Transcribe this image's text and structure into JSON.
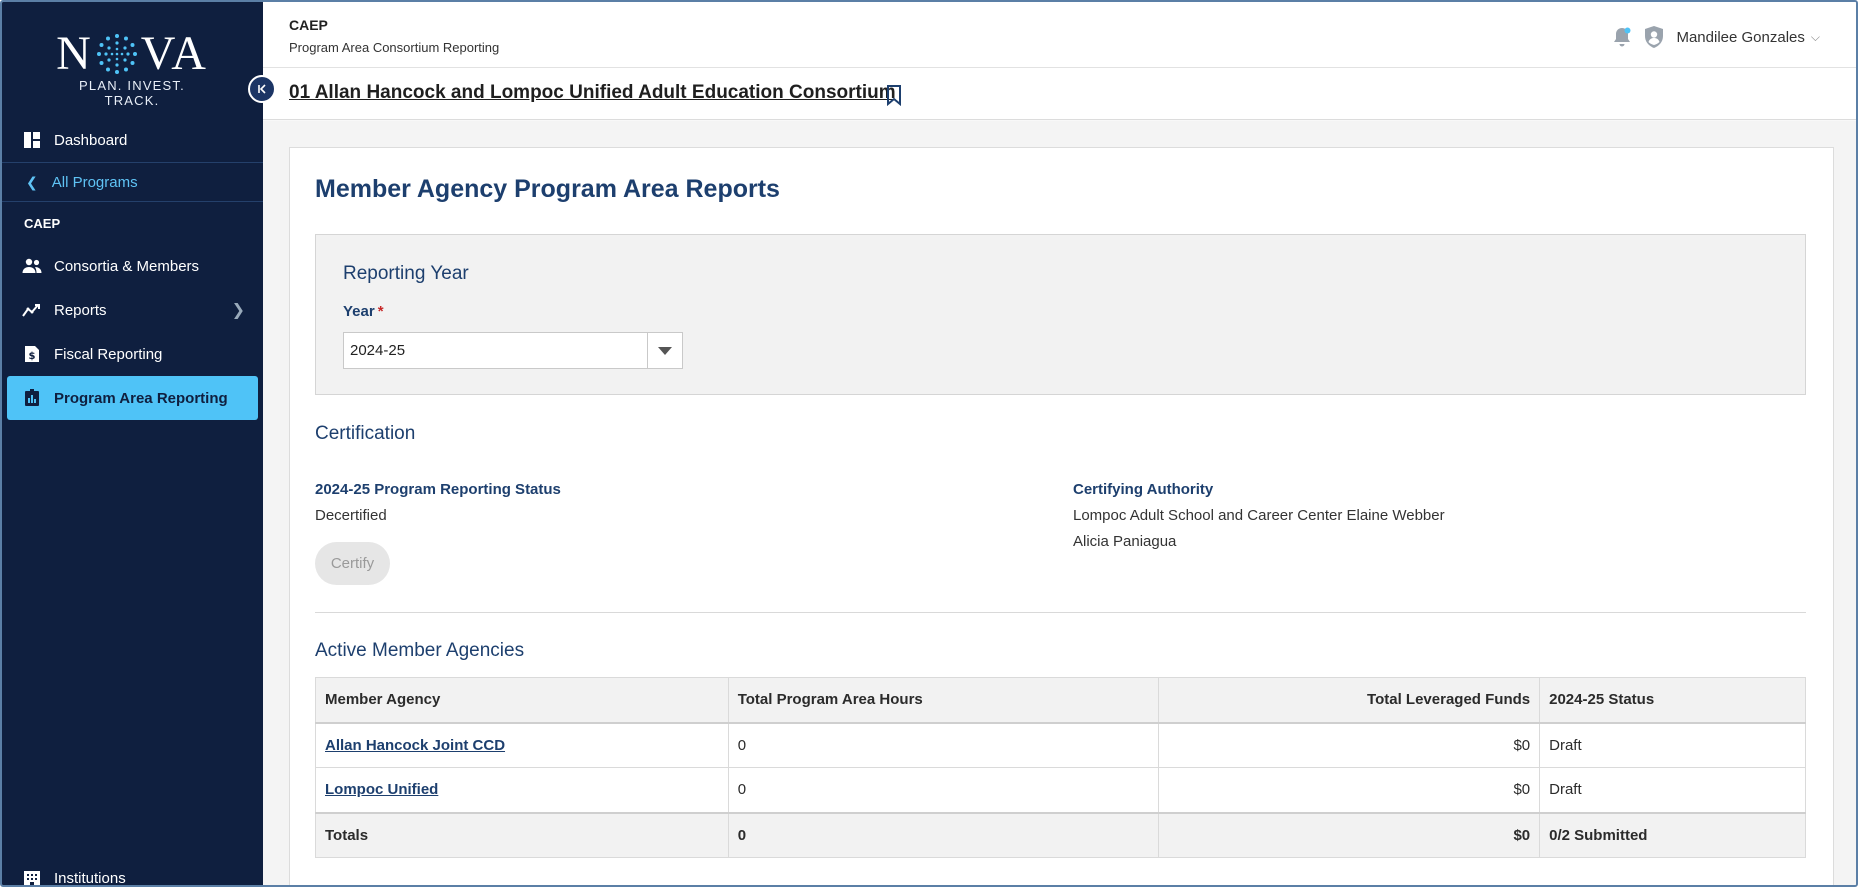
{
  "colors": {
    "sidebar_bg": "#0f1f3f",
    "accent": "#4fc3f7",
    "heading": "#1d3f6e",
    "required": "#c62828"
  },
  "brand": {
    "logo_word_left": "N",
    "logo_word_right": "VA",
    "tagline": "PLAN. INVEST. TRACK."
  },
  "sidebar": {
    "dashboard": {
      "label": "Dashboard",
      "icon": "dashboard-icon"
    },
    "back_link": {
      "label": "All Programs",
      "icon": "chevron-left-icon"
    },
    "section": "CAEP",
    "items": [
      {
        "label": "Consortia & Members",
        "icon": "users-icon"
      },
      {
        "label": "Reports",
        "icon": "chart-line-icon"
      },
      {
        "label": "Fiscal Reporting",
        "icon": "dollar-doc-icon"
      },
      {
        "label": "Program Area Reporting",
        "icon": "bar-chart-icon",
        "active": true
      }
    ],
    "bottom_item": {
      "label": "Institutions",
      "icon": "building-icon"
    }
  },
  "header": {
    "app": "CAEP",
    "subtitle": "Program Area Consortium Reporting",
    "user_name": "Mandilee Gonzales"
  },
  "consortium_title": "01 Allan Hancock and Lompoc Unified Adult Education Consortium",
  "main": {
    "page_title": "Member Agency Program Area Reports",
    "reporting_year": {
      "title": "Reporting Year",
      "field_label": "Year",
      "required_mark": "*",
      "selected": "2024-25"
    },
    "certification": {
      "title": "Certification",
      "status_label": "2024-25 Program Reporting Status",
      "status_value": "Decertified",
      "authority_label": "Certifying Authority",
      "authority_line1": "Lompoc Adult School and Career Center Elaine Webber",
      "authority_line2": "Alicia Paniagua",
      "certify_button": "Certify"
    },
    "agencies": {
      "title": "Active Member Agencies",
      "columns": [
        "Member Agency",
        "Total Program Area Hours",
        "Total Leveraged Funds",
        "2024-25 Status"
      ],
      "rows": [
        {
          "agency": "Allan Hancock Joint CCD",
          "hours": "0",
          "funds": "$0",
          "status": "Draft"
        },
        {
          "agency": "Lompoc Unified",
          "hours": "0",
          "funds": "$0",
          "status": "Draft"
        }
      ],
      "totals": {
        "label": "Totals",
        "hours": "0",
        "funds": "$0",
        "status": "0/2 Submitted"
      }
    }
  }
}
